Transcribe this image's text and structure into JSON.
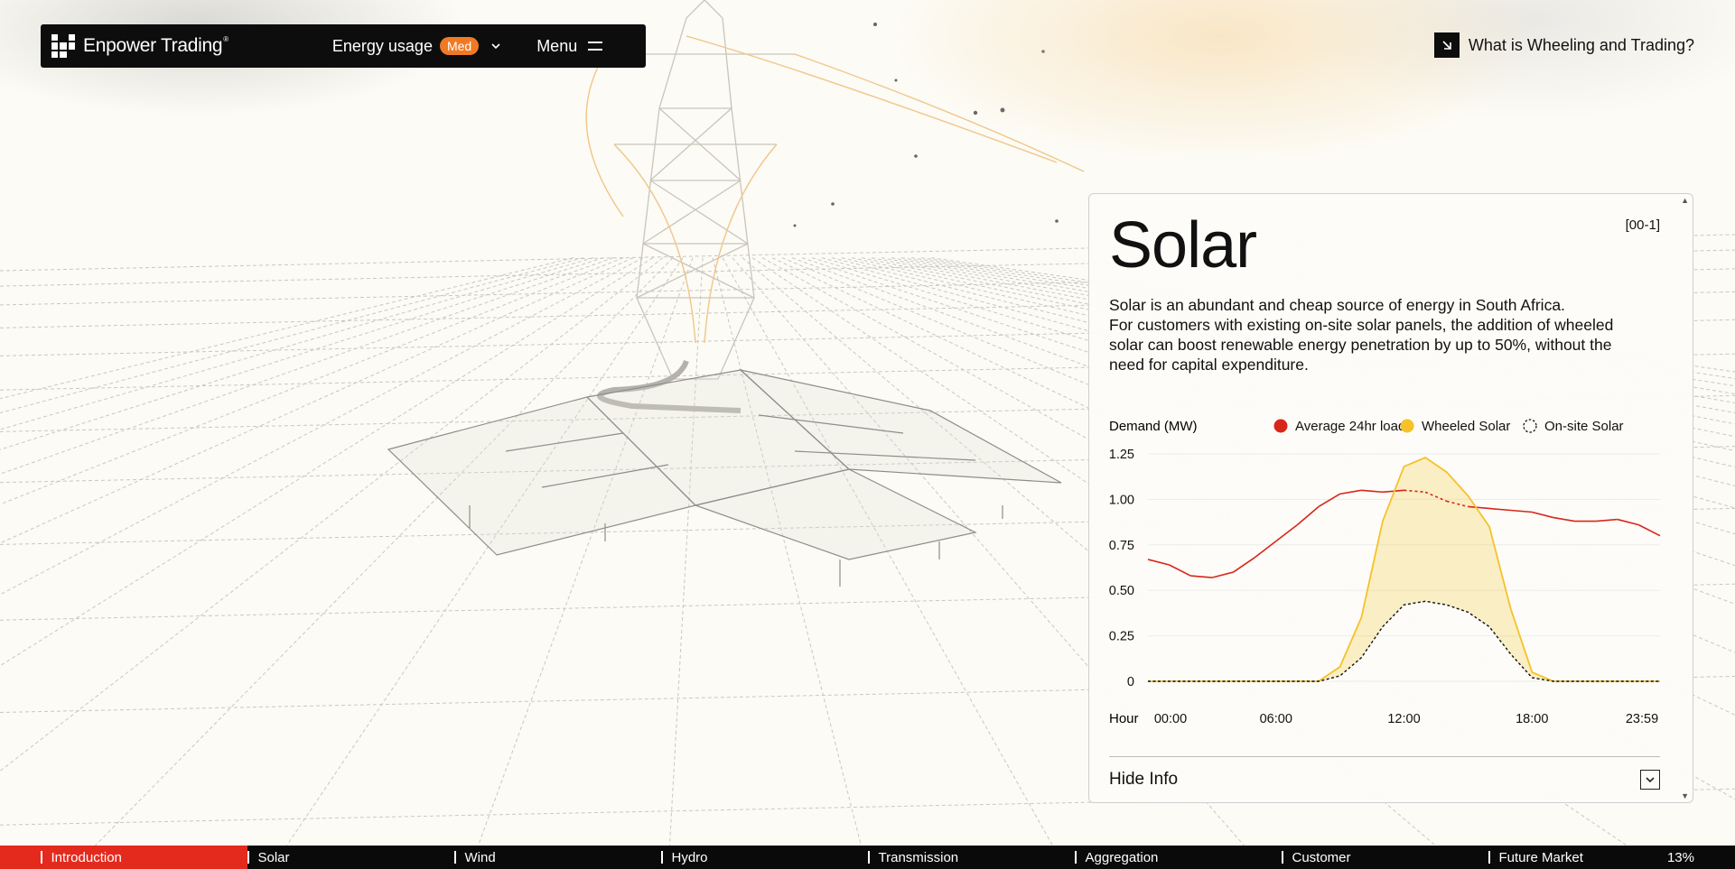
{
  "brand": {
    "name": "Enpower Trading",
    "mark": "®"
  },
  "nav": {
    "energy_label": "Energy usage",
    "energy_badge": "Med",
    "menu_label": "Menu"
  },
  "help_link": {
    "label": "What is Wheeling and Trading?"
  },
  "panel": {
    "title": "Solar",
    "code": "[00-1]",
    "description": [
      "Solar is an abundant and cheap source of energy in South Africa.",
      "For customers with existing on-site solar panels, the addition of wheeled solar can boost renewable energy penetration by up to 50%, without the need for capital expenditure."
    ],
    "hide_label": "Hide Info"
  },
  "chart_data": {
    "type": "area",
    "ylabel": "Demand (MW)",
    "xlabel": "Hour",
    "ylim": [
      0,
      1.25
    ],
    "yticks": [
      "1.25",
      "1.00",
      "0.75",
      "0.50",
      "0.25",
      "0"
    ],
    "ytick_values": [
      1.25,
      1.0,
      0.75,
      0.5,
      0.25,
      0
    ],
    "xticks": [
      "00:00",
      "06:00",
      "12:00",
      "18:00",
      "23:59"
    ],
    "xtick_hours": [
      0,
      6,
      12,
      18,
      24
    ],
    "legend": [
      {
        "name": "Average 24hr load",
        "color": "#d7261b",
        "style": "solid-dot"
      },
      {
        "name": "Wheeled Solar",
        "color": "#f5c228",
        "style": "solid-dot"
      },
      {
        "name": "On-site Solar",
        "color": "#111111",
        "style": "dashed-ring"
      }
    ],
    "series": [
      {
        "name": "Average 24hr load",
        "x": [
          0,
          1,
          2,
          3,
          4,
          5,
          6,
          7,
          8,
          9,
          10,
          11,
          12,
          13,
          14,
          15,
          16,
          17,
          18,
          19,
          20,
          21,
          22,
          23,
          24
        ],
        "values": [
          0.67,
          0.64,
          0.58,
          0.57,
          0.6,
          0.68,
          0.77,
          0.86,
          0.96,
          1.03,
          1.05,
          1.04,
          1.05,
          1.04,
          0.99,
          0.96,
          0.95,
          0.94,
          0.93,
          0.9,
          0.88,
          0.88,
          0.89,
          0.86,
          0.8
        ]
      },
      {
        "name": "Wheeled Solar",
        "x": [
          0,
          1,
          2,
          3,
          4,
          5,
          6,
          7,
          8,
          9,
          10,
          11,
          12,
          13,
          14,
          15,
          16,
          17,
          18,
          19,
          20,
          21,
          22,
          23,
          24
        ],
        "values": [
          0,
          0,
          0,
          0,
          0,
          0,
          0,
          0,
          0,
          0.08,
          0.35,
          0.88,
          1.18,
          1.23,
          1.15,
          1.02,
          0.85,
          0.4,
          0.05,
          0,
          0,
          0,
          0,
          0,
          0
        ]
      },
      {
        "name": "On-site Solar",
        "x": [
          0,
          1,
          2,
          3,
          4,
          5,
          6,
          7,
          8,
          9,
          10,
          11,
          12,
          13,
          14,
          15,
          16,
          17,
          18,
          19,
          20,
          21,
          22,
          23,
          24
        ],
        "values": [
          0,
          0,
          0,
          0,
          0,
          0,
          0,
          0,
          0,
          0.03,
          0.13,
          0.3,
          0.42,
          0.44,
          0.42,
          0.38,
          0.3,
          0.15,
          0.02,
          0,
          0,
          0,
          0,
          0,
          0
        ]
      }
    ]
  },
  "progress": {
    "fraction": 0.143,
    "percent_label": "13%",
    "sections": [
      "Introduction",
      "Solar",
      "Wind",
      "Hydro",
      "Transmission",
      "Aggregation",
      "Customer",
      "Future Market"
    ]
  }
}
